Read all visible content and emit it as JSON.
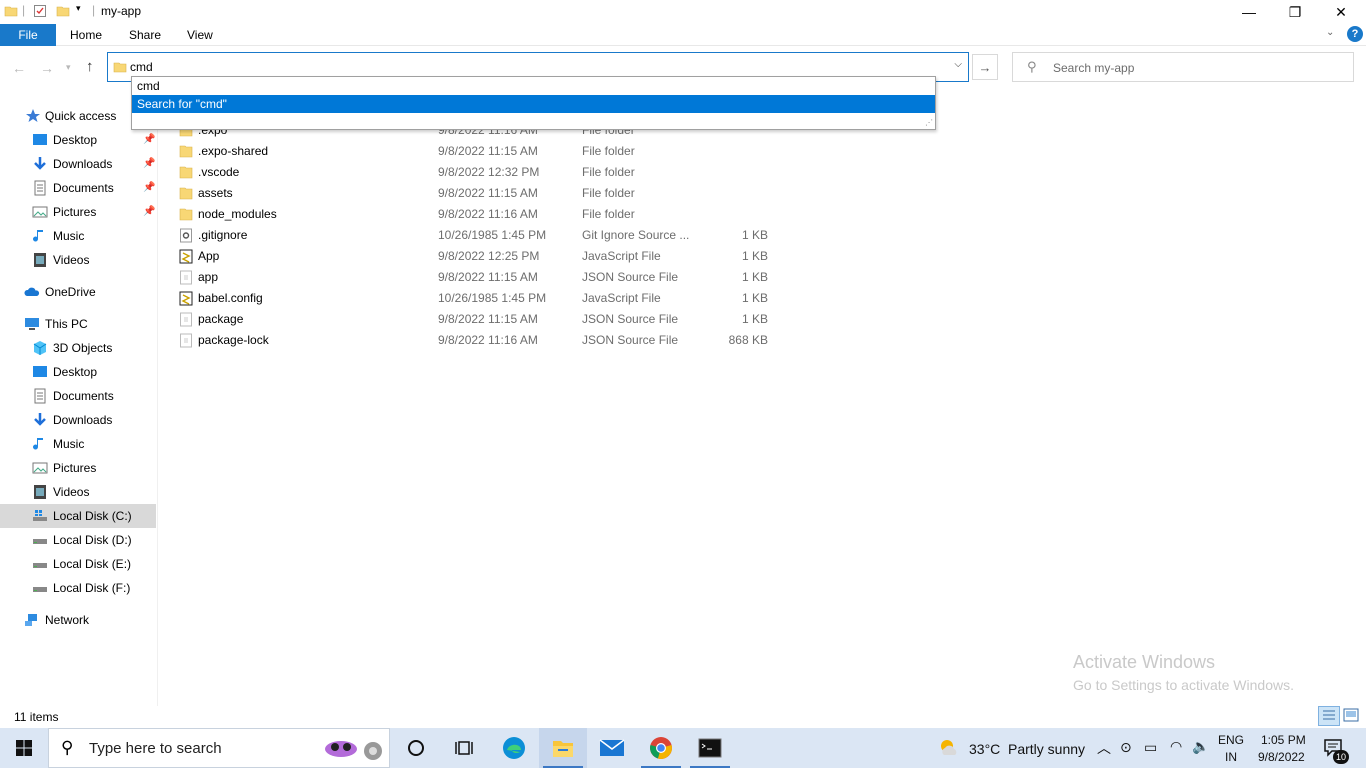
{
  "window": {
    "title": "my-app",
    "minimize": "—",
    "maximize": "❐",
    "close": "✕"
  },
  "ribbon": {
    "tabs": [
      "File",
      "Home",
      "Share",
      "View"
    ],
    "help": "?"
  },
  "address": {
    "value": "cmd",
    "autocomplete": [
      "cmd",
      "Search for \"cmd\""
    ]
  },
  "search": {
    "placeholder": "Search my-app"
  },
  "sidebar": {
    "quick_access": "Quick access",
    "quick_items": [
      "Desktop",
      "Downloads",
      "Documents",
      "Pictures",
      "Music",
      "Videos"
    ],
    "onedrive": "OneDrive",
    "this_pc": "This PC",
    "pc_items": [
      "3D Objects",
      "Desktop",
      "Documents",
      "Downloads",
      "Music",
      "Pictures",
      "Videos",
      "Local Disk (C:)",
      "Local Disk (D:)",
      "Local Disk (E:)",
      "Local Disk (F:)"
    ],
    "network": "Network"
  },
  "files": [
    {
      "name": ".expo",
      "date": "9/8/2022 11:16 AM",
      "type": "File folder",
      "size": "",
      "icon": "folder-icon"
    },
    {
      "name": ".expo-shared",
      "date": "9/8/2022 11:15 AM",
      "type": "File folder",
      "size": "",
      "icon": "folder-icon"
    },
    {
      "name": ".vscode",
      "date": "9/8/2022 12:32 PM",
      "type": "File folder",
      "size": "",
      "icon": "folder-icon"
    },
    {
      "name": "assets",
      "date": "9/8/2022 11:15 AM",
      "type": "File folder",
      "size": "",
      "icon": "folder-icon"
    },
    {
      "name": "node_modules",
      "date": "9/8/2022 11:16 AM",
      "type": "File folder",
      "size": "",
      "icon": "folder-icon"
    },
    {
      "name": ".gitignore",
      "date": "10/26/1985 1:45 PM",
      "type": "Git Ignore Source ...",
      "size": "1 KB",
      "icon": "gear-file-icon"
    },
    {
      "name": "App",
      "date": "9/8/2022 12:25 PM",
      "type": "JavaScript File",
      "size": "1 KB",
      "icon": "js-file-icon"
    },
    {
      "name": "app",
      "date": "9/8/2022 11:15 AM",
      "type": "JSON Source File",
      "size": "1 KB",
      "icon": "json-file-icon"
    },
    {
      "name": "babel.config",
      "date": "10/26/1985 1:45 PM",
      "type": "JavaScript File",
      "size": "1 KB",
      "icon": "js-file-icon"
    },
    {
      "name": "package",
      "date": "9/8/2022 11:15 AM",
      "type": "JSON Source File",
      "size": "1 KB",
      "icon": "json-file-icon"
    },
    {
      "name": "package-lock",
      "date": "9/8/2022 11:16 AM",
      "type": "JSON Source File",
      "size": "868 KB",
      "icon": "json-file-icon"
    }
  ],
  "status": {
    "count": "11 items"
  },
  "watermark": {
    "line1": "Activate Windows",
    "line2": "Go to Settings to activate Windows."
  },
  "taskbar": {
    "search_label": "Type here to search",
    "weather_temp": "33°C",
    "weather_text": "Partly sunny",
    "lang1": "ENG",
    "lang2": "IN",
    "time": "1:05 PM",
    "date": "9/8/2022",
    "notifications": "10"
  },
  "colors": {
    "accent": "#1979ca",
    "selection": "#0078d7",
    "folder": "#f8d775"
  }
}
